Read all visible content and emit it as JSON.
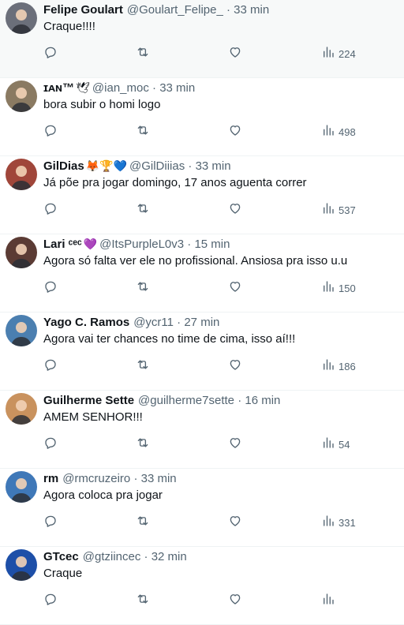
{
  "colors": {
    "text_primary": "#0f1419",
    "text_secondary": "#536471",
    "divider": "#eff3f4",
    "highlight_bg": "#f7f9f9"
  },
  "icons": {
    "reply": "reply-icon",
    "retweet": "retweet-icon",
    "like": "heart-icon",
    "views": "views-bar-chart-icon"
  },
  "replies": [
    {
      "name": "Felipe Goulart",
      "badges": "",
      "handle": "@Goulart_Felipe_",
      "separator": "·",
      "time": "33 min",
      "text": "Craque!!!!",
      "views": "224",
      "highlighted": true,
      "avatar_color": "#6b6f7a"
    },
    {
      "name": "ɪᴀɴ™",
      "badges": "🕊",
      "handle": "@ian_moc",
      "separator": "·",
      "time": "33 min",
      "text": "bora subir o homi logo",
      "views": "498",
      "highlighted": false,
      "avatar_color": "#8a7a62"
    },
    {
      "name": "GilDias",
      "badges": "🦊🏆💙",
      "handle": "@GilDiiias",
      "separator": "·",
      "time": "33 min",
      "text": "Já põe pra jogar domingo, 17 anos aguenta correr",
      "views": "537",
      "highlighted": false,
      "avatar_color": "#a0463a"
    },
    {
      "name": "Lari ᶜᵉᶜ",
      "badges": "💜",
      "handle": "@ItsPurpleL0v3",
      "separator": "·",
      "time": "15 min",
      "text": "Agora só falta ver ele no profissional. Ansiosa pra isso u.u",
      "views": "150",
      "highlighted": false,
      "avatar_color": "#5b3b34"
    },
    {
      "name": "Yago C. Ramos",
      "badges": "",
      "handle": "@ycr11",
      "separator": "·",
      "time": "27 min",
      "text": "Agora vai ter chances no time de cima, isso aí!!!",
      "views": "186",
      "highlighted": false,
      "avatar_color": "#4b7fb0"
    },
    {
      "name": "Guilherme Sette",
      "badges": "",
      "handle": "@guilherme7sette",
      "separator": "·",
      "time": "16 min",
      "text": "AMEM SENHOR!!!",
      "views": "54",
      "highlighted": false,
      "avatar_color": "#c9925e"
    },
    {
      "name": "rm",
      "badges": "",
      "handle": "@rmcruzeiro",
      "separator": "·",
      "time": "33 min",
      "text": "Agora coloca pra jogar",
      "views": "331",
      "highlighted": false,
      "avatar_color": "#3f78b8"
    },
    {
      "name": "GTcec",
      "badges": "",
      "handle": "@gtziincec",
      "separator": "·",
      "time": "32 min",
      "text": "Craque",
      "views": "",
      "highlighted": false,
      "avatar_color": "#1d4fa8"
    }
  ]
}
